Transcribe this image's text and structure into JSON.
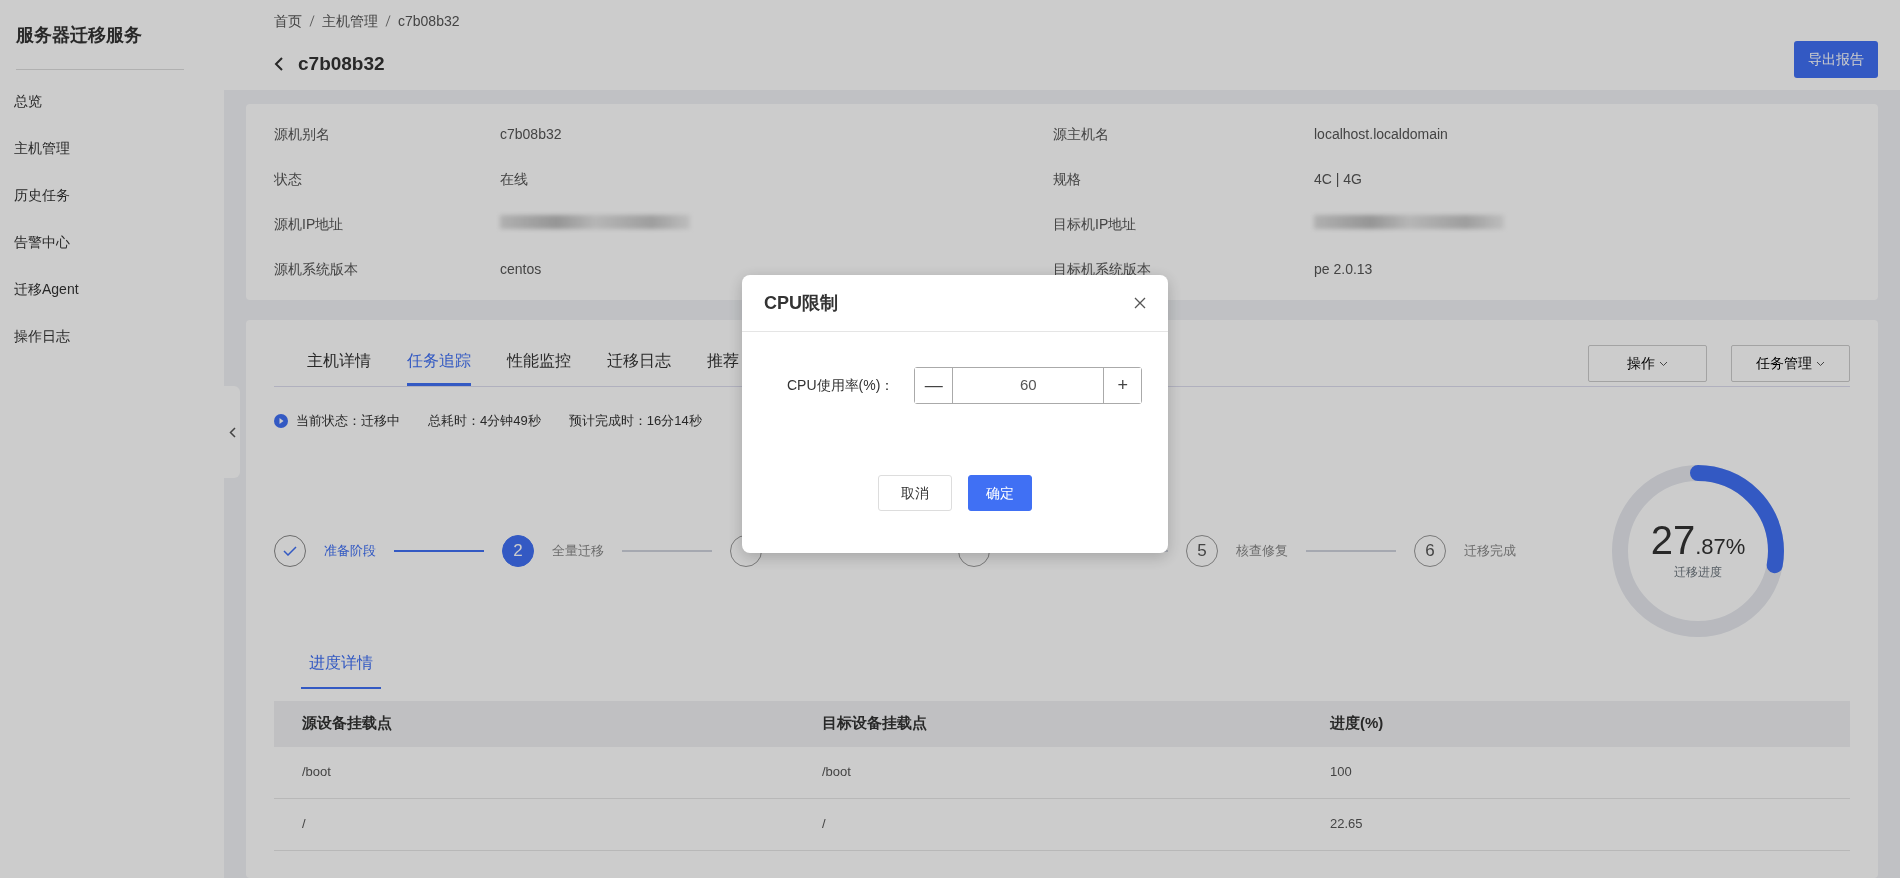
{
  "sidebar": {
    "title": "服务器迁移服务",
    "items": [
      {
        "label": "总览",
        "selected": false
      },
      {
        "label": "主机管理",
        "selected": false
      },
      {
        "label": "历史任务",
        "selected": false
      },
      {
        "label": "告警中心",
        "selected": false
      },
      {
        "label": "迁移Agent",
        "selected": false
      },
      {
        "label": "操作日志",
        "selected": false
      }
    ]
  },
  "breadcrumb": [
    "首页",
    "主机管理",
    "c7b08b32"
  ],
  "page_title": "c7b08b32",
  "export_button": "导出报告",
  "info": [
    {
      "label": "源机别名",
      "value": "c7b08b32",
      "redacted": false
    },
    {
      "label": "源主机名",
      "value": "localhost.localdomain",
      "redacted": false
    },
    {
      "label": "状态",
      "value": "在线",
      "redacted": false
    },
    {
      "label": "规格",
      "value": "4C | 4G",
      "redacted": false
    },
    {
      "label": "源机IP地址",
      "redacted": true
    },
    {
      "label": "目标机IP地址",
      "redacted": true
    },
    {
      "label": "源机系统版本",
      "value": "centos",
      "redacted": false
    },
    {
      "label": "目标机系统版本",
      "value": "pe 2.0.13",
      "redacted": false
    }
  ],
  "tabs": [
    {
      "label": "主机详情",
      "selected": false
    },
    {
      "label": "任务追踪",
      "selected": true
    },
    {
      "label": "性能监控",
      "selected": false
    },
    {
      "label": "迁移日志",
      "selected": false
    },
    {
      "label": "推荐",
      "selected": false
    }
  ],
  "actions": [
    "操作",
    "任务管理"
  ],
  "status_line": [
    "当前状态：迁移中",
    "总耗时：4分钟49秒",
    "预计完成时：16分14秒"
  ],
  "steps": [
    {
      "label": "准备阶段",
      "done": true,
      "active": false
    },
    {
      "number": "2",
      "label": "全量迁移",
      "done": false,
      "active": true
    },
    {
      "done": false,
      "active": false
    },
    {
      "done": false,
      "active": false
    },
    {
      "number": "5",
      "label": "核查修复",
      "done": false,
      "active": false
    },
    {
      "number": "6",
      "label": "迁移完成",
      "done": false,
      "active": false
    }
  ],
  "progress": {
    "level": 0.2787,
    "major": "27",
    "minor": ".87%",
    "caption": "迁移进度"
  },
  "detail_tab": {
    "label": "进度详情",
    "selected": true
  },
  "table": {
    "columns": [
      "源设备挂载点",
      "目标设备挂载点",
      "进度(%)"
    ],
    "rows": [
      [
        "/boot",
        "/boot",
        "100"
      ],
      [
        "/",
        "/",
        "22.65"
      ]
    ]
  },
  "modal": {
    "title": "CPU限制",
    "field_label": "CPU使用率(%)：",
    "value": "60",
    "minus": "—",
    "plus": "+",
    "buttons": [
      {
        "label": "取消",
        "kind": "default"
      },
      {
        "label": "确定",
        "kind": "primary"
      }
    ]
  }
}
